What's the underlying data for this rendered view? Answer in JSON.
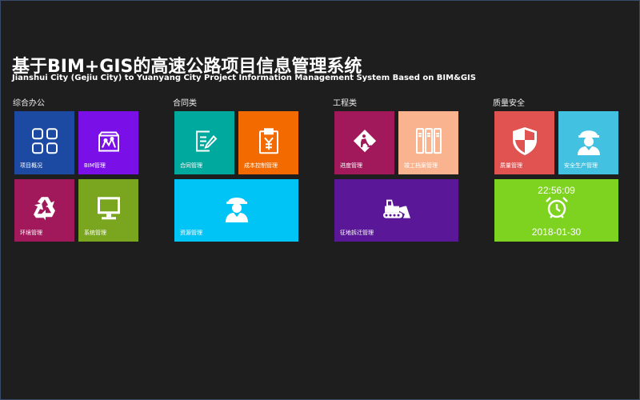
{
  "header": {
    "title": "基于BIM+GIS的高速公路项目信息管理系统",
    "subtitle": "Jianshui City (Gejiu City) to Yuanyang City Project Information Management System Based on BIM&GIS"
  },
  "groups": {
    "office": {
      "label": "综合办公"
    },
    "contract": {
      "label": "合同类"
    },
    "engineering": {
      "label": "工程类"
    },
    "quality": {
      "label": "质量安全"
    }
  },
  "tiles": {
    "project_overview": {
      "label": "项目概况",
      "color": "#1c4aa3",
      "icon": "grid-icon"
    },
    "bim_management": {
      "label": "BIM管理",
      "color": "#7a0fe8",
      "icon": "bim-model-icon"
    },
    "environment_management": {
      "label": "环境管理",
      "color": "#a1185b",
      "icon": "recycle-icon"
    },
    "system_management": {
      "label": "系统管理",
      "color": "#7aa51e",
      "icon": "monitor-icon"
    },
    "contract_management": {
      "label": "合同管理",
      "color": "#00a99e",
      "icon": "contract-icon"
    },
    "cost_control": {
      "label": "成本控制管理",
      "color": "#f26a00",
      "icon": "clipboard-yen-icon"
    },
    "resource_management": {
      "label": "资源管理",
      "color": "#00c4f5",
      "icon": "worker-icon"
    },
    "progress_management": {
      "label": "进度管理",
      "color": "#a1185b",
      "icon": "road-work-sign-icon"
    },
    "archive_management": {
      "label": "竣工档案管理",
      "color": "#f9b48f",
      "icon": "binders-icon"
    },
    "land_demolition": {
      "label": "征地拆迁管理",
      "color": "#5a1898",
      "icon": "bulldozer-icon"
    },
    "quality_management": {
      "label": "质量管理",
      "color": "#e05350",
      "icon": "shield-icon"
    },
    "safety_management": {
      "label": "安全生产管理",
      "color": "#43c1e0",
      "icon": "safety-helmet-icon"
    }
  },
  "clock": {
    "time": "22:56:09",
    "date": "2018-01-30",
    "color": "#7ed321",
    "icon": "alarm-clock-icon"
  }
}
